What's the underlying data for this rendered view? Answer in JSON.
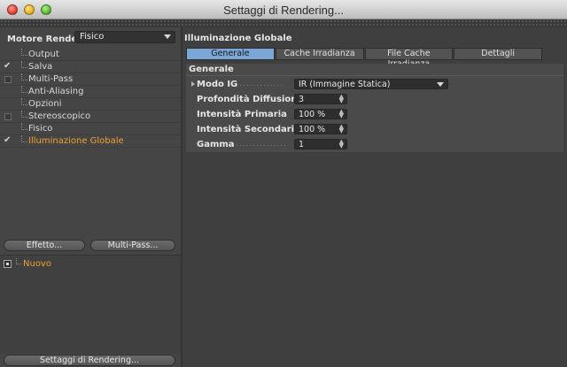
{
  "window": {
    "title": "Settaggi di Rendering..."
  },
  "engine": {
    "label": "Motore Render",
    "value": "Fisico"
  },
  "tree": [
    {
      "label": "Output",
      "check": "none"
    },
    {
      "label": "Salva",
      "check": "checked"
    },
    {
      "label": "Multi-Pass",
      "check": "box"
    },
    {
      "label": "Anti-Aliasing",
      "check": "none"
    },
    {
      "label": "Opzioni",
      "check": "none"
    },
    {
      "label": "Stereoscopico",
      "check": "box"
    },
    {
      "label": "Fisico",
      "check": "none"
    },
    {
      "label": "Illuminazione Globale",
      "check": "checked",
      "active": true
    }
  ],
  "buttons": {
    "effects": "Effetto...",
    "multipass": "Multi-Pass...",
    "render_settings": "Settaggi di Rendering..."
  },
  "presets": [
    {
      "label": "Nuovo"
    }
  ],
  "panel": {
    "title": "Illuminazione Globale",
    "tabs": [
      {
        "label": "Generale",
        "selected": true
      },
      {
        "label": "Cache Irradianza",
        "selected": false
      },
      {
        "label": "File Cache Irradianza",
        "selected": false
      },
      {
        "label": "Dettagli",
        "selected": false
      }
    ],
    "group": "Generale",
    "fields": {
      "mode": {
        "label": "Modo IG",
        "value": "IR (Immagine Statica)"
      },
      "depth": {
        "label": "Profondità Diffusione",
        "value": "3"
      },
      "primary": {
        "label": "Intensità Primaria",
        "value": "100 %"
      },
      "secondary": {
        "label": "Intensità Secondaria",
        "value": "100 %"
      },
      "gamma": {
        "label": "Gamma",
        "value": "1"
      }
    }
  },
  "colors": {
    "accent_tab": "#7aa6d8",
    "active_item": "#f0a030"
  },
  "icons": {
    "check": "checkmark-icon",
    "dropdown": "chevron-down-icon",
    "spinner": "spinner-arrows-icon"
  }
}
